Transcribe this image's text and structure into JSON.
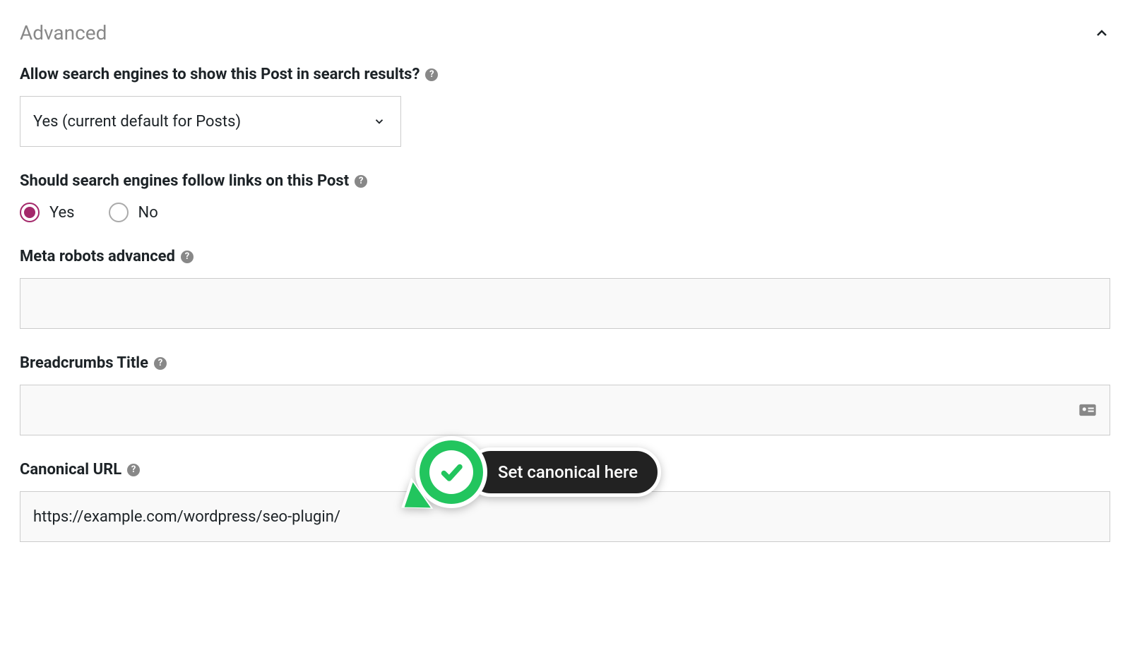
{
  "panel": {
    "title": "Advanced"
  },
  "fields": {
    "allow_search": {
      "label": "Allow search engines to show this Post in search results?",
      "value": "Yes (current default for Posts)"
    },
    "follow_links": {
      "label": "Should search engines follow links on this Post",
      "options": {
        "yes": "Yes",
        "no": "No"
      }
    },
    "meta_robots": {
      "label": "Meta robots advanced",
      "value": ""
    },
    "breadcrumbs": {
      "label": "Breadcrumbs Title",
      "value": ""
    },
    "canonical": {
      "label": "Canonical URL",
      "value": "https://example.com/wordpress/seo-plugin/"
    }
  },
  "callout": {
    "text": "Set canonical here"
  }
}
